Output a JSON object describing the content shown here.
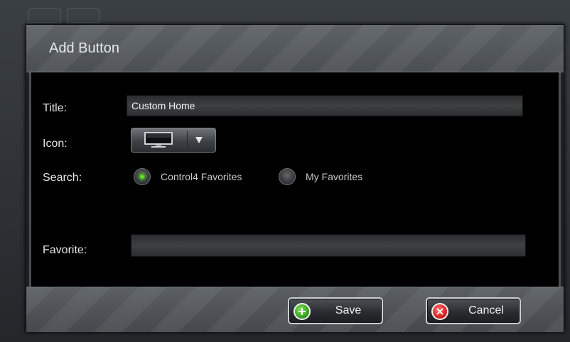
{
  "dialog": {
    "title": "Add Button"
  },
  "form": {
    "title_label": "Title:",
    "title_value": "Custom Home",
    "icon_label": "Icon:",
    "icon_selected": "monitor-icon",
    "search_label": "Search:",
    "search_options": [
      {
        "label": "Control4 Favorites",
        "selected": true
      },
      {
        "label": "My Favorites",
        "selected": false
      }
    ],
    "favorite_label": "Favorite:",
    "favorite_value": ""
  },
  "footer": {
    "save_label": "Save",
    "save_icon": "plus-icon",
    "cancel_label": "Cancel",
    "cancel_icon": "x-icon"
  },
  "colors": {
    "accent_selected": "#4fdc1a",
    "save_icon": "#2f9c1a",
    "cancel_icon": "#d41818"
  }
}
